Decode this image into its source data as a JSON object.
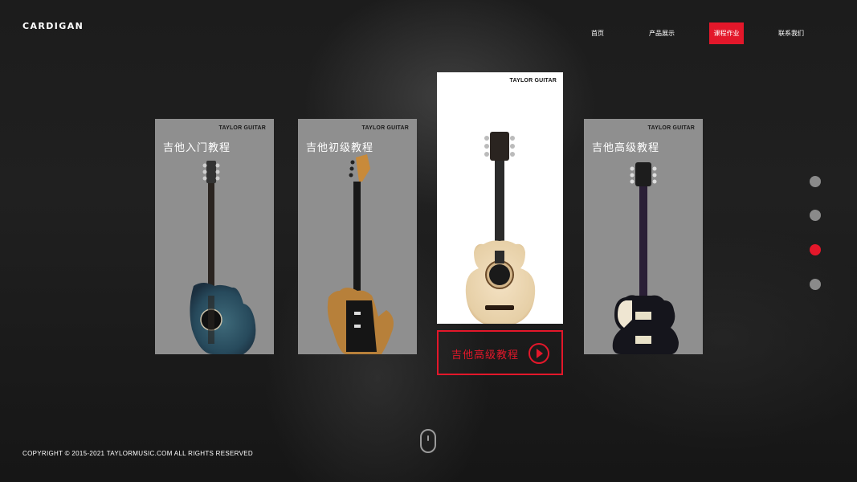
{
  "logo": "CARDIGAN",
  "nav": {
    "items": [
      {
        "label": "首页",
        "active": false
      },
      {
        "label": "产品展示",
        "active": false
      },
      {
        "label": "课程作业",
        "active": true
      },
      {
        "label": "联系我们",
        "active": false
      }
    ]
  },
  "cards": [
    {
      "brand": "TAYLOR GUITAR",
      "title": "吉他入门教程",
      "guitar": "acoustic-electric-cutaway-icon"
    },
    {
      "brand": "TAYLOR GUITAR",
      "title": "吉他初级教程",
      "guitar": "electric-guitar-icon"
    },
    {
      "brand": "TAYLOR GUITAR",
      "title": "",
      "guitar": "acoustic-guitar-icon",
      "featured": true
    },
    {
      "brand": "TAYLOR GUITAR",
      "title": "吉他高级教程",
      "guitar": "les-paul-guitar-icon"
    }
  ],
  "cta": {
    "label": "吉他高级教程",
    "icon": "play-icon"
  },
  "pager": {
    "count": 4,
    "active_index": 2
  },
  "scroll_hint": "mouse-icon",
  "footer": {
    "copyright": "COPYRIGHT © 2015-2021 TAYLORMUSIC.COM ALL RIGHTS RESERVED"
  },
  "colors": {
    "accent": "#e3172a",
    "card_bg": "#8f8f8f",
    "page_bg": "#141414"
  }
}
